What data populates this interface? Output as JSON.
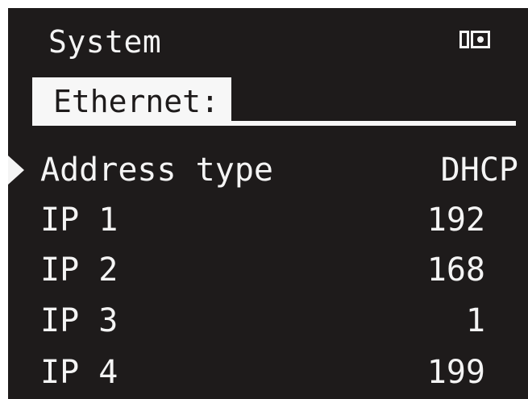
{
  "header": {
    "title": "System",
    "status_icon": "battery-status-icon"
  },
  "tab": {
    "label": "Ethernet:"
  },
  "menu": {
    "selected_index": 0,
    "items": [
      {
        "label": "Address type",
        "value": "DHCP"
      },
      {
        "label": "IP 1",
        "value": "192"
      },
      {
        "label": "IP 2",
        "value": "168"
      },
      {
        "label": "IP 3",
        "value": "1"
      },
      {
        "label": "IP 4",
        "value": "199"
      }
    ]
  },
  "colors": {
    "background": "#1e1b1b",
    "foreground": "#f4f4f4",
    "highlight": "#f7f7f7"
  }
}
